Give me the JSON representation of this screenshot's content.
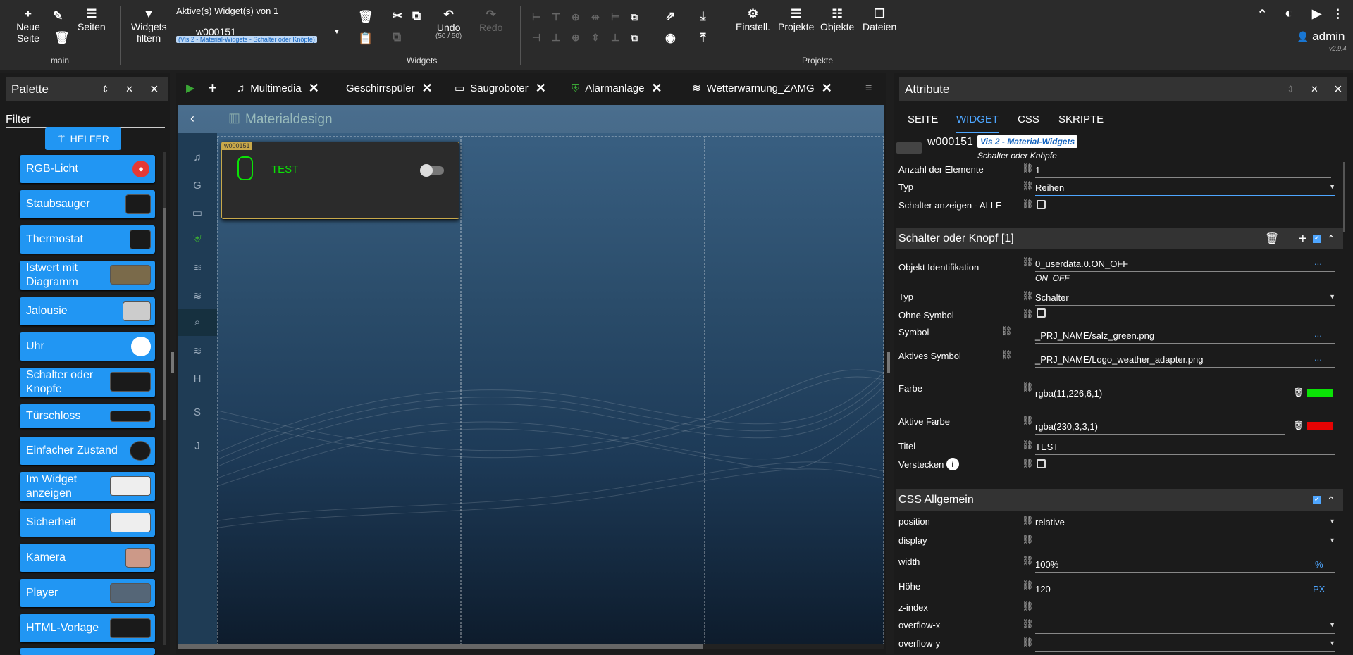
{
  "toolbar": {
    "new_page": "Neue Seite",
    "pages": "Seiten",
    "main": "main",
    "filter": "Widgets filtern",
    "active_widgets": "Aktive(s) Widget(s) von 1",
    "widget_id": "w000151",
    "widget_set": "(Vis 2 - Material-Widgets - Schalter oder Knöpfe)",
    "undo": "Undo",
    "undo_count": "(50 / 50)",
    "redo": "Redo",
    "widgets_group": "Widgets",
    "settings": "Einstell.",
    "projects": "Projekte",
    "objects": "Objekte",
    "files": "Dateien",
    "projects_group": "Projekte",
    "user": "admin",
    "version": "v2.9.4"
  },
  "palette": {
    "title": "Palette",
    "filter": "Filter",
    "helper": "HELFER",
    "items": [
      {
        "label": "RGB-Licht"
      },
      {
        "label": "Staubsauger"
      },
      {
        "label": "Thermostat"
      },
      {
        "label": "Istwert mit Diagramm"
      },
      {
        "label": "Jalousie"
      },
      {
        "label": "Uhr"
      },
      {
        "label": "Schalter oder Knöpfe"
      },
      {
        "label": "Türschloss"
      },
      {
        "label": "Einfacher Zustand"
      },
      {
        "label": "Im Widget anzeigen"
      },
      {
        "label": "Sicherheit"
      },
      {
        "label": "Kamera"
      },
      {
        "label": "Player"
      },
      {
        "label": "HTML-Vorlage"
      }
    ]
  },
  "editor": {
    "tabs": [
      {
        "label": "Multimedia"
      },
      {
        "label": "Geschirrspüler"
      },
      {
        "label": "Saugroboter"
      },
      {
        "label": "Alarmanlage"
      },
      {
        "label": "Wetterwarnung_ZAMG"
      }
    ],
    "page_title": "Materialdesign",
    "nav_letters": [
      "G",
      "H",
      "S",
      "J"
    ],
    "widget_tag": "w000151",
    "widget_title": "TEST"
  },
  "attributes": {
    "title": "Attribute",
    "tabs": {
      "seite": "SEITE",
      "widget": "WIDGET",
      "css": "CSS",
      "skripte": "SKRIPTE"
    },
    "widget_id": "w000151",
    "widget_set": "Vis 2 - Material-Widgets",
    "widget_type": "Schalter oder Knöpfe",
    "general": [
      {
        "label": "Anzahl der Elemente",
        "value": "1"
      },
      {
        "label": "Typ",
        "value": "Reihen"
      },
      {
        "label": "Schalter anzeigen - ALLE",
        "value": ""
      }
    ],
    "section1": "Schalter oder Knopf [1]",
    "oid_label": "Objekt Identifikation",
    "oid_value": "0_userdata.0.ON_OFF",
    "oid_name": "ON_OFF",
    "typ_label": "Typ",
    "typ_value": "Schalter",
    "nosym_label": "Ohne Symbol",
    "sym_label": "Symbol",
    "sym_value": "_PRJ_NAME/salz_green.png",
    "asym_label": "Aktives Symbol",
    "asym_value": "_PRJ_NAME/Logo_weather_adapter.png",
    "color_label": "Farbe",
    "color_value": "rgba(11,226,6,1)",
    "color_swatch": "#0be206",
    "acolor_label": "Aktive Farbe",
    "acolor_value": "rgba(230,3,3,1)",
    "acolor_swatch": "#e60303",
    "title_label": "Titel",
    "title_value": "TEST",
    "hide_label": "Verstecken",
    "section2": "CSS Allgemein",
    "css": [
      {
        "label": "position",
        "value": "relative",
        "unit": ""
      },
      {
        "label": "display",
        "value": "",
        "unit": ""
      },
      {
        "label": "width",
        "value": "100%",
        "unit": "%"
      },
      {
        "label": "Höhe",
        "value": "120",
        "unit": "PX"
      },
      {
        "label": "z-index",
        "value": "",
        "unit": ""
      },
      {
        "label": "overflow-x",
        "value": "",
        "unit": ""
      },
      {
        "label": "overflow-y",
        "value": "",
        "unit": ""
      }
    ]
  }
}
